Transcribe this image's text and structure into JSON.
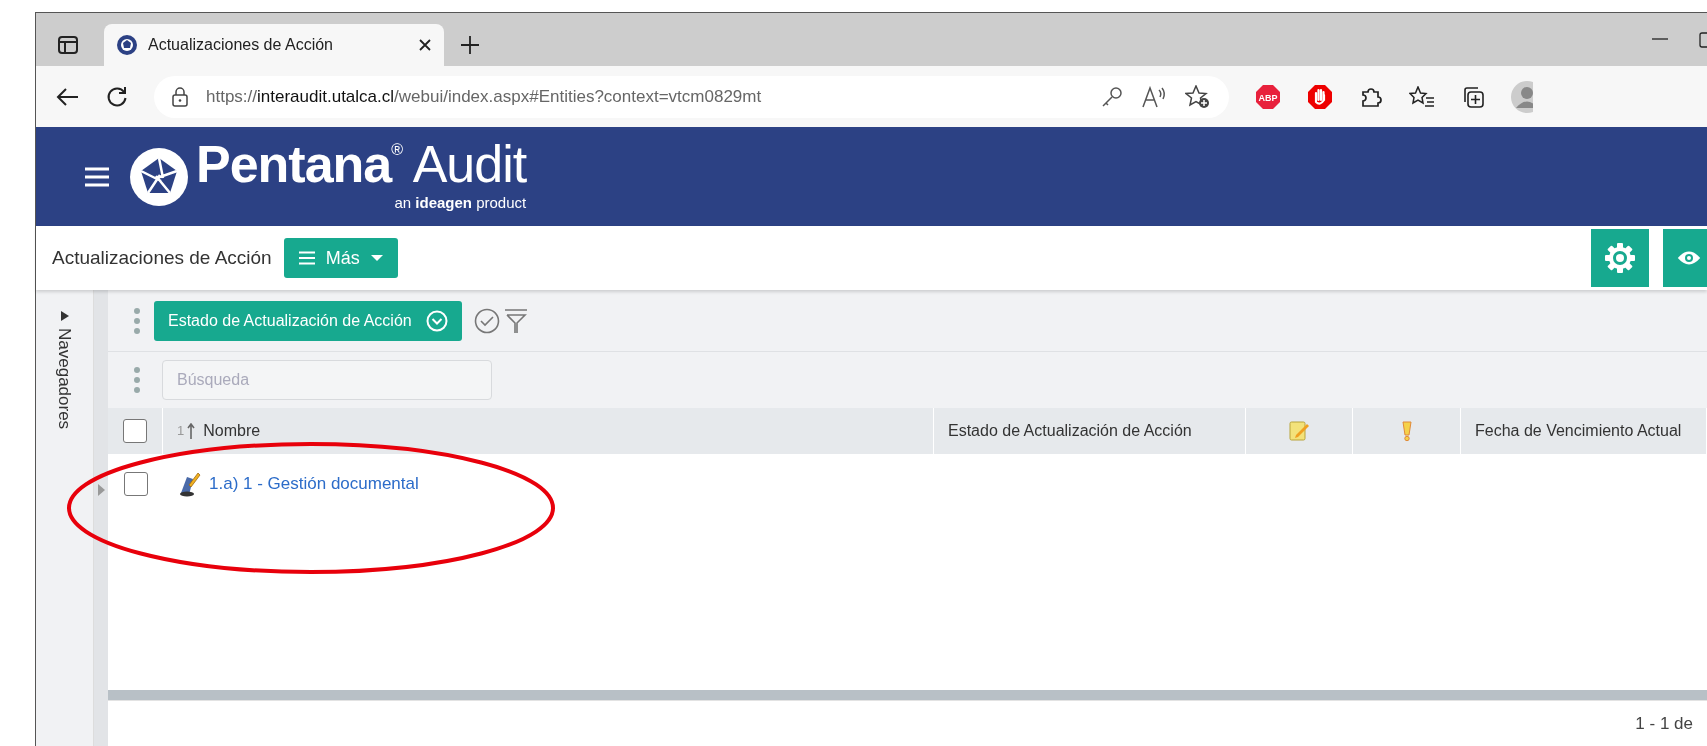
{
  "browser": {
    "tab_title": "Actualizaciones de Acción",
    "url_scheme": "https://",
    "url_host": "interaudit.utalca.cl",
    "url_path": "/webui/index.aspx#Entities?context=vtcm0829mt",
    "abp_label": "ABP"
  },
  "app": {
    "logo": "**Pentana**$^{®}$ Audit",
    "tagline": "an **ideagen** product"
  },
  "toolbar": {
    "title": "Actualizaciones de Acción",
    "more_button": "Más"
  },
  "side_panel": {
    "label": "Navegadores",
    "expanded": false
  },
  "filter_chip": "Estado de Actualización de Acción",
  "search": {
    "placeholder": "Búsqueda"
  },
  "table": {
    "header_checked": false,
    "columns": [
      {
        "kind": "text",
        "label": "Nombre",
        "sort_order": "1"
      },
      {
        "kind": "text",
        "label": "Estado de Actualización de Acción"
      },
      {
        "kind": "icon"
      },
      {
        "kind": "icon"
      },
      {
        "kind": "text",
        "label": "Fecha de Vencimiento Actual"
      }
    ],
    "rows": [
      {
        "checked": false,
        "name": "1.a) 1 - Gestión documental"
      }
    ]
  },
  "footer": "1 - 1 de"
}
